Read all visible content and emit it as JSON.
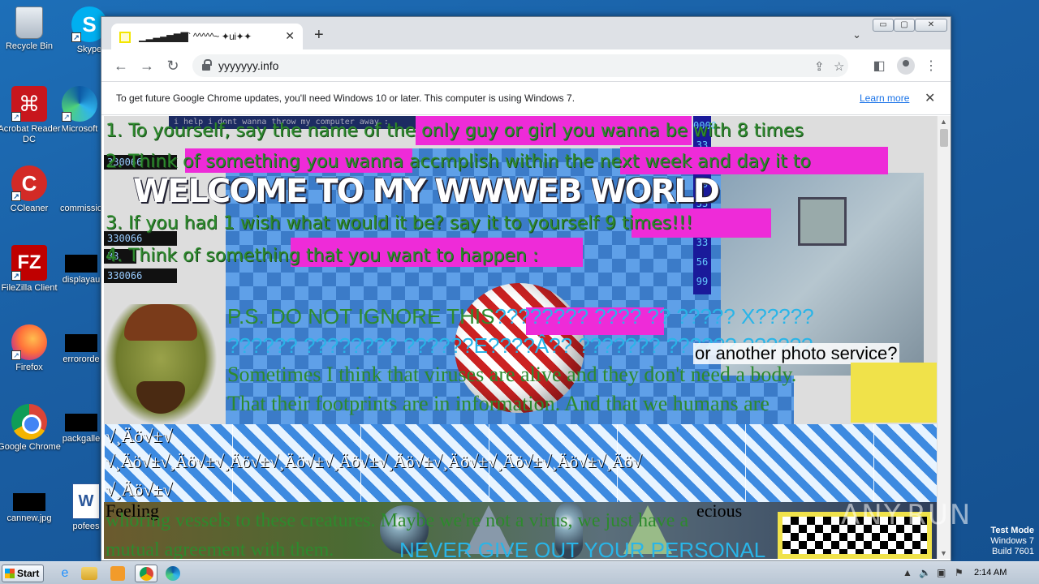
{
  "desktop": {
    "icons": [
      {
        "label": "Recycle Bin",
        "icon": "recycle-bin-icon"
      },
      {
        "label": "Skype",
        "icon": "skype-icon"
      },
      {
        "label": "Acrobat Reader DC",
        "icon": "acrobat-icon"
      },
      {
        "label": "Microsoft",
        "icon": "edge-icon"
      },
      {
        "label": "CCleaner",
        "icon": "ccleaner-icon"
      },
      {
        "label": "commissio",
        "icon": "file-icon"
      },
      {
        "label": "FileZilla Client",
        "icon": "filezilla-icon"
      },
      {
        "label": "displayau",
        "icon": "file-icon"
      },
      {
        "label": "Firefox",
        "icon": "firefox-icon"
      },
      {
        "label": "errororde",
        "icon": "file-icon"
      },
      {
        "label": "Google Chrome",
        "icon": "chrome-icon"
      },
      {
        "label": "packgalle",
        "icon": "file-icon"
      },
      {
        "label": "cannew.jpg",
        "icon": "file-icon"
      },
      {
        "label": "pofees",
        "icon": "word-icon"
      }
    ]
  },
  "browser": {
    "tab": {
      "title": "▁▂▃▄▅▆▇` ^^^^^~ ✦ui✦✦"
    },
    "new_tab": "+",
    "tab_menu": "⌄",
    "window_controls": {
      "minimize": "▭",
      "maximize": "▢",
      "close": "✕"
    },
    "nav": {
      "back": "←",
      "forward": "→",
      "reload": "↻"
    },
    "url": "yyyyyyy.info",
    "infobar": {
      "message": "To get future Google Chrome updates, you'll need Windows 10 or later. This computer is using Windows 7.",
      "link": "Learn more",
      "close": "✕"
    }
  },
  "page": {
    "terminal_text": "i help i dont wanna throw my computer away :",
    "code_strip": [
      "330066",
      "330066",
      "33",
      "33",
      "330066"
    ],
    "blue_col": [
      "0000",
      "33",
      "33",
      "99",
      "33",
      "00",
      "33",
      "56",
      "99"
    ],
    "headline": "WELCOME TO MY  WWWEB WORLD",
    "lines": [
      "1. To yourself, say the name of the only guy or girl you wanna be with 8 times",
      "2. Think of something you wanna accmplish within the next week and day it to",
      "3. If you had 1 wish what would it be? say it to yourself 9 times!!!",
      "4. Think of something that you want to happen :"
    ],
    "ps_line1_red": "P.S. DO NOT IGNORE THIS",
    "ps_line1_cyan": "???????? ???? ?? ????? X?????",
    "ps_line2": "?????? ???????? ??????E????Â?? ??????? ?????? ??????",
    "ad_text": "or another photo service?",
    "serif_lines": [
      "Sometimes I think that viruses are alive and they don't need a body.",
      "That their footprints are in information. And that we humans are"
    ],
    "garble": [
      "√¸Äö√±√",
      "√¸Äö√±√¸Äö√±√¸Äö√±√¸Äö√±√¸Äö√±√¸Äö√±√¸Äö√±√¸Äö√±√¸Äö√±√¸Äö√",
      "√¸Äö√±√"
    ],
    "bottom_word": "Feeling",
    "precious": "ecious",
    "bottom_lines": [
      "whoring vessels to these creatures. Maybe we're not a virus, we just have a",
      "mutual agreement with them."
    ],
    "never_text": "NEVER GIVE OUT YOUR PERSONAL"
  },
  "taskbar": {
    "start": "Start",
    "clock": "2:14 AM",
    "apps": [
      "ie-icon",
      "explorer-icon",
      "media-player-icon",
      "chrome-icon",
      "edge-icon"
    ]
  },
  "watermark": "ANY.RUN",
  "test_mode": {
    "line1": "Test Mode",
    "line2": "Windows 7",
    "line3": "Build 7601"
  },
  "colors": {
    "desktop": "#1a5ea3",
    "tab_strip": "#dee1e6",
    "link": "#1a73e8",
    "green_text": "#2e8b2e",
    "ps_red": "#2e8b2e",
    "ps_cyan": "#29b5e8",
    "pink_bar": "#ee2bd8"
  }
}
